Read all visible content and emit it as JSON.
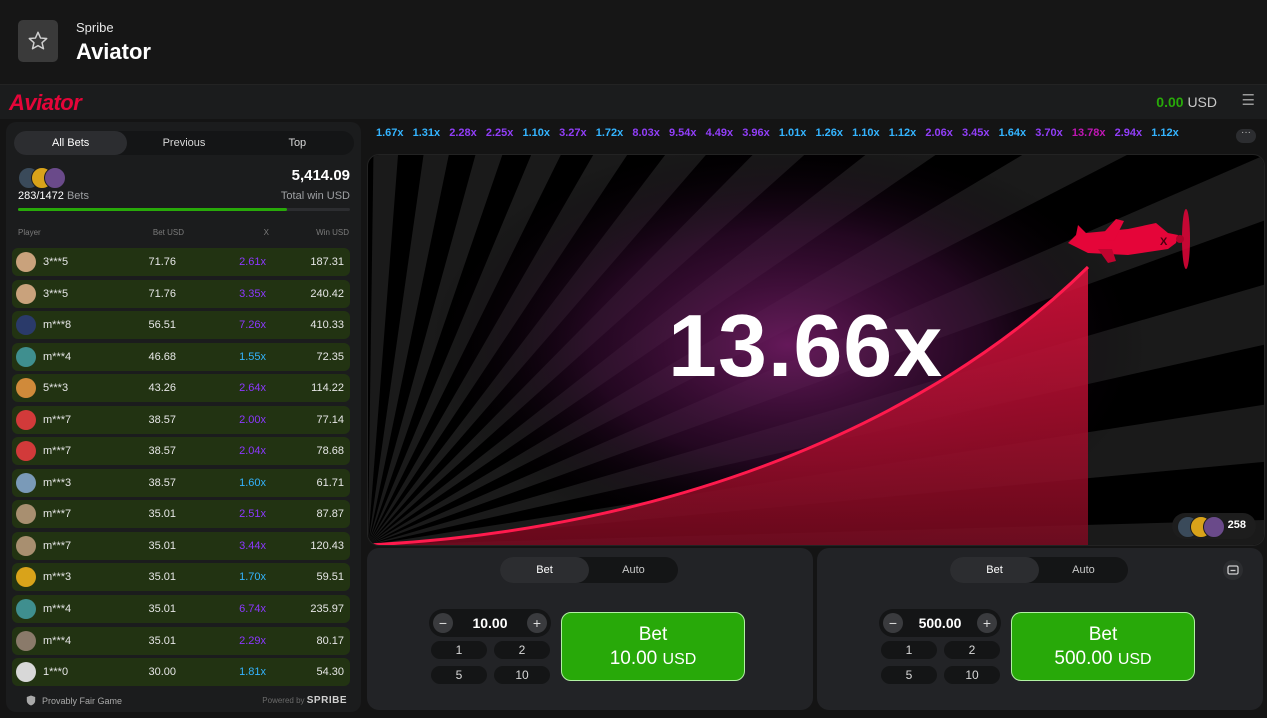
{
  "app": {
    "provider": "Spribe",
    "title": "Aviator"
  },
  "header": {
    "logo": "Aviator",
    "balance": "0.00",
    "currency": "USD"
  },
  "bets_panel": {
    "tabs": [
      "All Bets",
      "Previous",
      "Top"
    ],
    "bets_count": "283/1472",
    "bets_label": "Bets",
    "total_win": "5,414.09",
    "total_win_label": "Total win USD",
    "progress": 0.81,
    "columns": [
      "Player",
      "Bet USD",
      "X",
      "Win USD"
    ],
    "rows": [
      {
        "player": "3***5",
        "bet": "71.76",
        "x": "2.61x",
        "win": "187.31",
        "xcolor": "#8c38ff",
        "av": "#c9a27c"
      },
      {
        "player": "3***5",
        "bet": "71.76",
        "x": "3.35x",
        "win": "240.42",
        "xcolor": "#8c38ff",
        "av": "#c9a27c"
      },
      {
        "player": "m***8",
        "bet": "56.51",
        "x": "7.26x",
        "win": "410.33",
        "xcolor": "#8c38ff",
        "av": "#2a3a6a"
      },
      {
        "player": "m***4",
        "bet": "46.68",
        "x": "1.55x",
        "win": "72.35",
        "xcolor": "#34b4ff",
        "av": "#3f8f8f"
      },
      {
        "player": "5***3",
        "bet": "43.26",
        "x": "2.64x",
        "win": "114.22",
        "xcolor": "#8c38ff",
        "av": "#d08a3a"
      },
      {
        "player": "m***7",
        "bet": "38.57",
        "x": "2.00x",
        "win": "77.14",
        "xcolor": "#8c38ff",
        "av": "#d23a3a"
      },
      {
        "player": "m***7",
        "bet": "38.57",
        "x": "2.04x",
        "win": "78.68",
        "xcolor": "#8c38ff",
        "av": "#d23a3a"
      },
      {
        "player": "m***3",
        "bet": "38.57",
        "x": "1.60x",
        "win": "61.71",
        "xcolor": "#34b4ff",
        "av": "#7a9ab8"
      },
      {
        "player": "m***7",
        "bet": "35.01",
        "x": "2.51x",
        "win": "87.87",
        "xcolor": "#8c38ff",
        "av": "#a88f70"
      },
      {
        "player": "m***7",
        "bet": "35.01",
        "x": "3.44x",
        "win": "120.43",
        "xcolor": "#8c38ff",
        "av": "#a88f70"
      },
      {
        "player": "m***3",
        "bet": "35.01",
        "x": "1.70x",
        "win": "59.51",
        "xcolor": "#34b4ff",
        "av": "#d9a31a"
      },
      {
        "player": "m***4",
        "bet": "35.01",
        "x": "6.74x",
        "win": "235.97",
        "xcolor": "#8c38ff",
        "av": "#3f8f8f"
      },
      {
        "player": "m***4",
        "bet": "35.01",
        "x": "2.29x",
        "win": "80.17",
        "xcolor": "#8c38ff",
        "av": "#8a7a6a"
      },
      {
        "player": "1***0",
        "bet": "30.00",
        "x": "1.81x",
        "win": "54.30",
        "xcolor": "#34b4ff",
        "av": "#d8d8d8"
      }
    ],
    "footer_fair": "Provably Fair Game",
    "footer_powered": "Powered by",
    "footer_brand": "SPRIBE"
  },
  "multipliers": [
    {
      "v": "1.67x",
      "c": "#34b4ff"
    },
    {
      "v": "1.31x",
      "c": "#34b4ff"
    },
    {
      "v": "2.28x",
      "c": "#913ef8"
    },
    {
      "v": "2.25x",
      "c": "#913ef8"
    },
    {
      "v": "1.10x",
      "c": "#34b4ff"
    },
    {
      "v": "3.27x",
      "c": "#913ef8"
    },
    {
      "v": "1.72x",
      "c": "#34b4ff"
    },
    {
      "v": "8.03x",
      "c": "#913ef8"
    },
    {
      "v": "9.54x",
      "c": "#913ef8"
    },
    {
      "v": "4.49x",
      "c": "#913ef8"
    },
    {
      "v": "3.96x",
      "c": "#913ef8"
    },
    {
      "v": "1.01x",
      "c": "#34b4ff"
    },
    {
      "v": "1.26x",
      "c": "#34b4ff"
    },
    {
      "v": "1.10x",
      "c": "#34b4ff"
    },
    {
      "v": "1.12x",
      "c": "#34b4ff"
    },
    {
      "v": "2.06x",
      "c": "#913ef8"
    },
    {
      "v": "3.45x",
      "c": "#913ef8"
    },
    {
      "v": "1.64x",
      "c": "#34b4ff"
    },
    {
      "v": "3.70x",
      "c": "#913ef8"
    },
    {
      "v": "13.78x",
      "c": "#c017b4"
    },
    {
      "v": "2.94x",
      "c": "#913ef8"
    },
    {
      "v": "1.12x",
      "c": "#34b4ff"
    }
  ],
  "game": {
    "multiplier": "13.66x",
    "players_count": "258"
  },
  "panels": [
    {
      "tabs": [
        "Bet",
        "Auto"
      ],
      "amount": "10.00",
      "quick": [
        "1",
        "2",
        "5",
        "10"
      ],
      "button_label": "Bet",
      "button_amount": "10.00",
      "button_currency": "USD"
    },
    {
      "tabs": [
        "Bet",
        "Auto"
      ],
      "amount": "500.00",
      "quick": [
        "1",
        "2",
        "5",
        "10"
      ],
      "button_label": "Bet",
      "button_amount": "500.00",
      "button_currency": "USD"
    }
  ]
}
